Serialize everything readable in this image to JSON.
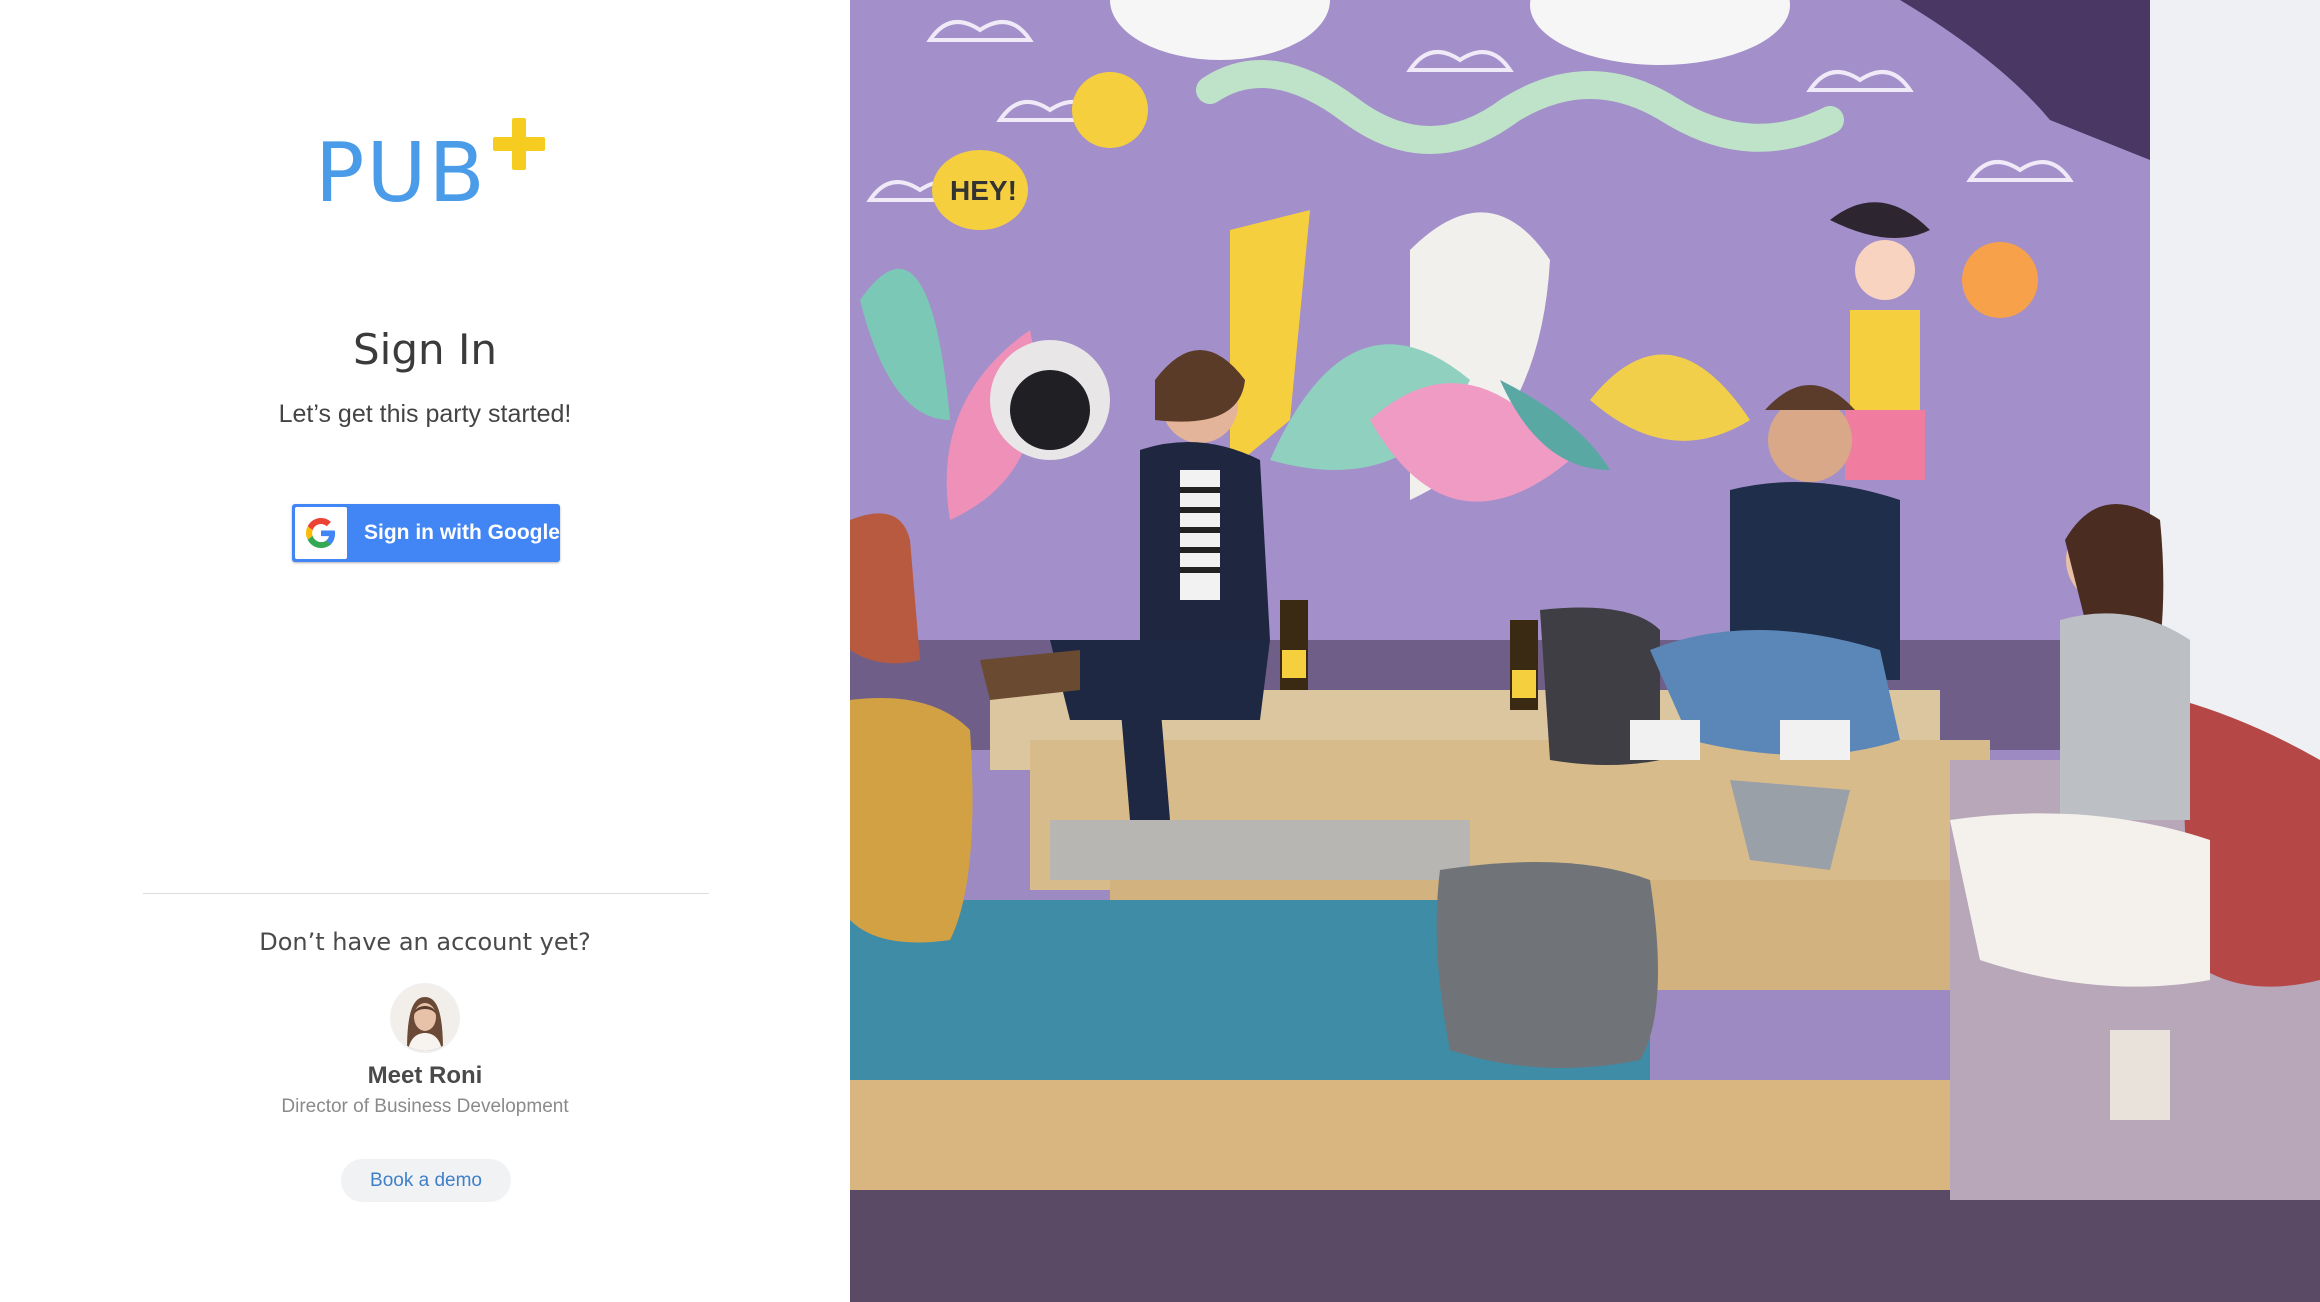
{
  "brand": {
    "logo_text": "PUB",
    "logo_color": "#4a9be8",
    "plus_color": "#f5cc1f"
  },
  "signin": {
    "title": "Sign In",
    "subtitle": "Let’s get this party started!",
    "google_button_label": "Sign in with Google",
    "google_icon": "google-g-icon",
    "button_color": "#4285f4"
  },
  "demo": {
    "question": "Don’t have an account yet?",
    "name": "Meet Roni",
    "role": "Director of Business Development",
    "button_label": "Book a demo"
  },
  "hero": {
    "image": "office-lounge-mural-photo"
  }
}
